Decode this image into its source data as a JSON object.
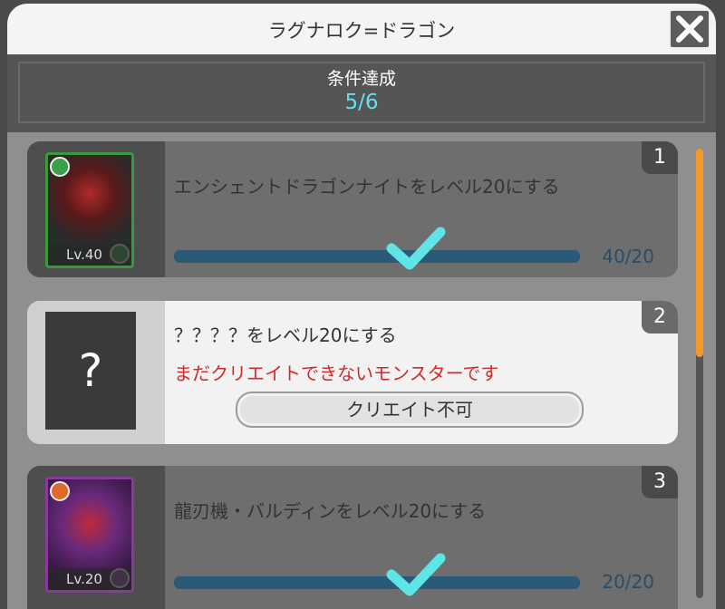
{
  "dialog": {
    "title": "ラグナロク=ドラゴン",
    "close_icon": "close-x-icon"
  },
  "status": {
    "label": "条件達成",
    "value": "5/6",
    "value_color": "#5fe3f0"
  },
  "missions": [
    {
      "number": "1",
      "text": "エンシェントドラゴンナイトをレベル20にする",
      "portrait_level": "Lv.40",
      "progress_text": "40/20",
      "progress": 1.0,
      "completed": true,
      "element": "green"
    },
    {
      "number": "2",
      "text": "？？？？をレベル20にする",
      "unknown_symbol": "?",
      "warning": "まだクリエイトできないモンスターです",
      "button_label": "クリエイト不可",
      "warning_color": "#d22a2a"
    },
    {
      "number": "3",
      "text": "龍刃機・バルディンをレベル20にする",
      "portrait_level": "Lv.20",
      "progress_text": "20/20",
      "progress": 1.0,
      "completed": true,
      "element": "purple"
    }
  ],
  "colors": {
    "check": "#5ee6e6",
    "scrollbar": "#f39a2a"
  }
}
